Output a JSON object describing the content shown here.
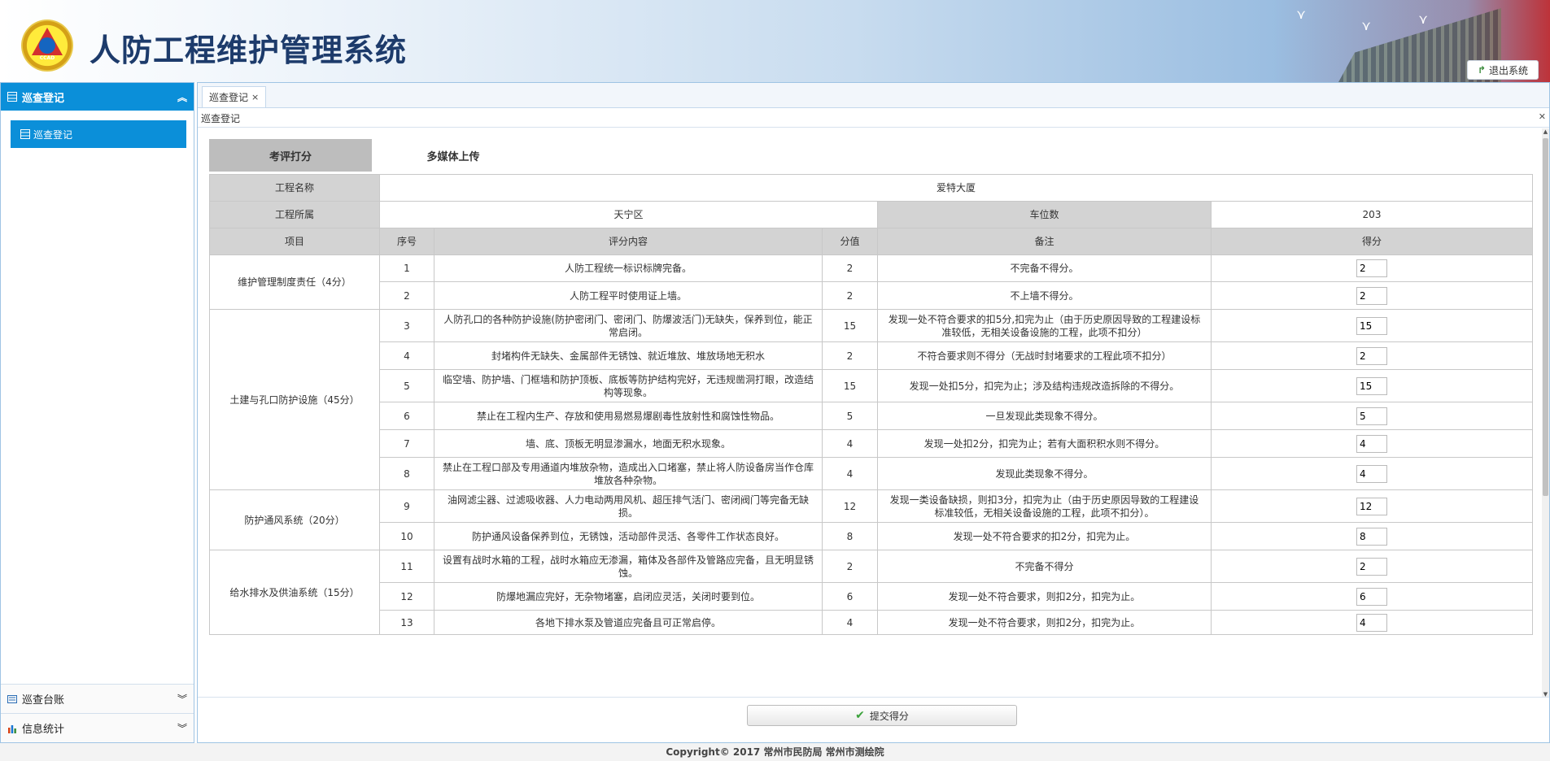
{
  "header": {
    "title": "人防工程维护管理系统",
    "logo_text": "CCAD",
    "logout_label": "退出系统"
  },
  "sidebar": {
    "sections": [
      {
        "label": "巡查登记",
        "icon": "grid-icon",
        "items": [
          {
            "label": "巡查登记"
          }
        ]
      },
      {
        "label": "巡查台账",
        "icon": "ledger-icon"
      },
      {
        "label": "信息统计",
        "icon": "bar-chart-icon"
      }
    ]
  },
  "tabs": [
    {
      "label": "巡查登记"
    }
  ],
  "panel": {
    "title": "巡查登记"
  },
  "subtabs": [
    {
      "label": "考评打分"
    },
    {
      "label": "多媒体上传"
    }
  ],
  "project": {
    "name_label": "工程名称",
    "name_value": "爱特大厦",
    "area_label": "工程所属",
    "area_value": "天宁区",
    "parking_label": "车位数",
    "parking_value": "203"
  },
  "columns": {
    "item": "项目",
    "no": "序号",
    "content": "评分内容",
    "points": "分值",
    "note": "备注",
    "score": "得分"
  },
  "groups": [
    {
      "name": "维护管理制度责任（4分）",
      "rows": [
        {
          "no": "1",
          "content": "人防工程统一标识标牌完备。",
          "points": "2",
          "note": "不完备不得分。",
          "score": "2"
        },
        {
          "no": "2",
          "content": "人防工程平时使用证上墙。",
          "points": "2",
          "note": "不上墙不得分。",
          "score": "2"
        }
      ]
    },
    {
      "name": "土建与孔口防护设施（45分）",
      "rows": [
        {
          "no": "3",
          "content": "人防孔口的各种防护设施(防护密闭门、密闭门、防爆波活门)无缺失，保养到位，能正常启闭。",
          "points": "15",
          "note": "发现一处不符合要求的扣5分,扣完为止（由于历史原因导致的工程建设标准较低，无相关设备设施的工程，此项不扣分）",
          "score": "15"
        },
        {
          "no": "4",
          "content": "封堵构件无缺失、金属部件无锈蚀、就近堆放、堆放场地无积水",
          "points": "2",
          "note": "不符合要求则不得分（无战时封堵要求的工程此项不扣分）",
          "score": "2"
        },
        {
          "no": "5",
          "content": "临空墙、防护墙、门框墙和防护顶板、底板等防护结构完好，无违规凿洞打眼，改造结构等现象。",
          "points": "15",
          "note": "发现一处扣5分，扣完为止；涉及结构违规改造拆除的不得分。",
          "score": "15"
        },
        {
          "no": "6",
          "content": "禁止在工程内生产、存放和使用易燃易爆剧毒性放射性和腐蚀性物品。",
          "points": "5",
          "note": "一旦发现此类现象不得分。",
          "score": "5"
        },
        {
          "no": "7",
          "content": "墙、底、顶板无明显渗漏水，地面无积水现象。",
          "points": "4",
          "note": "发现一处扣2分，扣完为止；若有大面积积水则不得分。",
          "score": "4"
        },
        {
          "no": "8",
          "content": "禁止在工程口部及专用通道内堆放杂物，造成出入口堵塞，禁止将人防设备房当作仓库堆放各种杂物。",
          "points": "4",
          "note": "发现此类现象不得分。",
          "score": "4"
        }
      ]
    },
    {
      "name": "防护通风系统（20分）",
      "rows": [
        {
          "no": "9",
          "content": "油网滤尘器、过滤吸收器、人力电动两用风机、超压排气活门、密闭阀门等完备无缺损。",
          "points": "12",
          "note": "发现一类设备缺损，则扣3分，扣完为止（由于历史原因导致的工程建设标准较低，无相关设备设施的工程，此项不扣分）。",
          "score": "12"
        },
        {
          "no": "10",
          "content": "防护通风设备保养到位，无锈蚀，活动部件灵活、各零件工作状态良好。",
          "points": "8",
          "note": "发现一处不符合要求的扣2分，扣完为止。",
          "score": "8"
        }
      ]
    },
    {
      "name": "给水排水及供油系统（15分）",
      "rows": [
        {
          "no": "11",
          "content": "设置有战时水箱的工程，战时水箱应无渗漏，箱体及各部件及管路应完备，且无明显锈蚀。",
          "points": "2",
          "note": "不完备不得分",
          "score": "2"
        },
        {
          "no": "12",
          "content": "防爆地漏应完好，无杂物堵塞，启闭应灵活，关闭时要到位。",
          "points": "6",
          "note": "发现一处不符合要求，则扣2分，扣完为止。",
          "score": "6"
        },
        {
          "no": "13",
          "content": "各地下排水泵及管道应完备且可正常启停。",
          "points": "4",
          "note": "发现一处不符合要求，则扣2分，扣完为止。",
          "score": "4"
        }
      ]
    }
  ],
  "submit_label": "提交得分",
  "copyright": "Copyright© 2017 常州市民防局 常州市测绘院"
}
